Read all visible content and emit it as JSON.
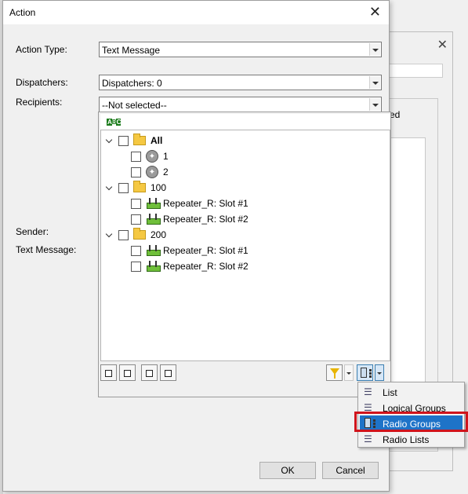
{
  "dialog": {
    "title": "Action",
    "close_glyph": "✕"
  },
  "fields": {
    "action_type_label": "Action Type:",
    "action_type_value": "Text Message",
    "dispatchers_label": "Dispatchers:",
    "dispatchers_value": "Dispatchers: 0",
    "recipients_label": "Recipients:",
    "recipients_value": "--Not selected--",
    "sender_label": "Sender:",
    "text_message_label": "Text Message:"
  },
  "tree": {
    "abc_icon": "abc-sort-icon",
    "nodes": [
      {
        "label": "All",
        "type": "folder",
        "bold": true
      },
      {
        "label": "1",
        "type": "person"
      },
      {
        "label": "2",
        "type": "person"
      },
      {
        "label": "100",
        "type": "folder"
      },
      {
        "label": "Repeater_R: Slot #1",
        "type": "repeater"
      },
      {
        "label": "Repeater_R: Slot #2",
        "type": "repeater"
      },
      {
        "label": "200",
        "type": "folder"
      },
      {
        "label": "Repeater_R: Slot #1",
        "type": "repeater"
      },
      {
        "label": "Repeater_R: Slot #2",
        "type": "repeater"
      }
    ]
  },
  "menu": {
    "items": [
      {
        "label": "List",
        "icon": "list-icon"
      },
      {
        "label": "Logical Groups",
        "icon": "logical-groups-icon"
      },
      {
        "label": "Radio Groups",
        "icon": "radio-groups-icon",
        "highlighted": true
      },
      {
        "label": "Radio Lists",
        "icon": "radio-lists-icon"
      }
    ]
  },
  "buttons": {
    "ok": "OK",
    "cancel": "Cancel"
  },
  "background_window": {
    "partial_label": "ed",
    "close_glyph": "✕"
  },
  "colors": {
    "highlight": "#1e73c8",
    "annotation_box": "#d0141c"
  }
}
